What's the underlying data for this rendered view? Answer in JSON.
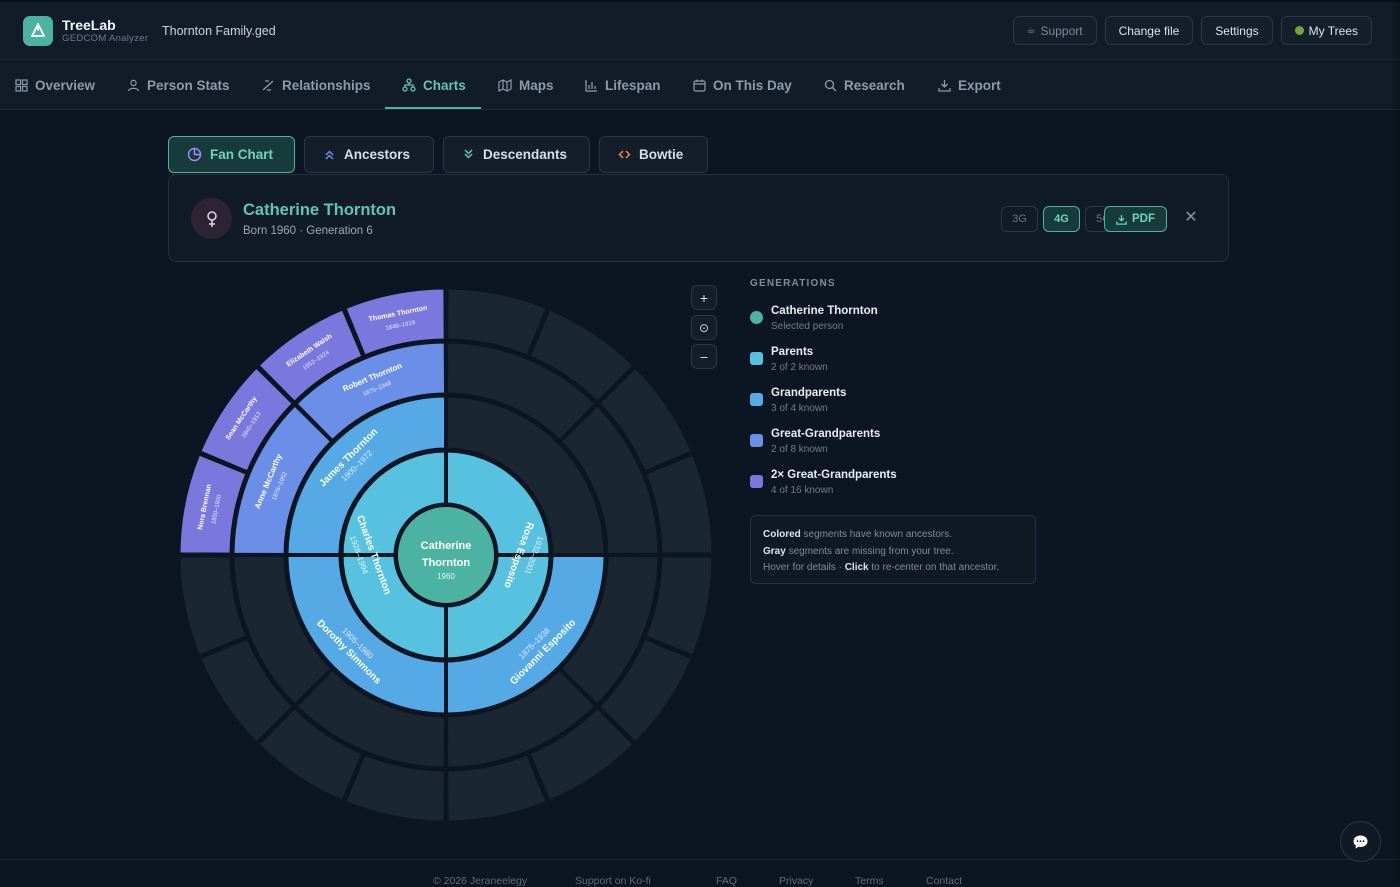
{
  "app": {
    "name": "TreeLab",
    "subtitle": "GEDCOM Analyzer",
    "file": "Thornton Family.ged"
  },
  "top_actions": {
    "support": "Support",
    "change_file": "Change file",
    "settings": "Settings",
    "my_trees": "My Trees"
  },
  "nav": {
    "tabs": [
      {
        "label": "Overview",
        "icon": "grid-icon"
      },
      {
        "label": "Person Stats",
        "icon": "user-icon"
      },
      {
        "label": "Relationships",
        "icon": "link-icon"
      },
      {
        "label": "Charts",
        "icon": "tree-chart-icon"
      },
      {
        "label": "Maps",
        "icon": "map-icon"
      },
      {
        "label": "Lifespan",
        "icon": "bar-chart-icon"
      },
      {
        "label": "On This Day",
        "icon": "calendar-icon"
      },
      {
        "label": "Research",
        "icon": "search-icon"
      },
      {
        "label": "Export",
        "icon": "download-icon"
      }
    ],
    "active": "Charts"
  },
  "chart_tabs": [
    {
      "label": "Fan Chart",
      "icon": "pie-icon"
    },
    {
      "label": "Ancestors",
      "icon": "chevrons-up-icon"
    },
    {
      "label": "Descendants",
      "icon": "chevrons-down-icon"
    },
    {
      "label": "Bowtie",
      "icon": "code-brackets-icon"
    }
  ],
  "person": {
    "name": "Catherine Thornton",
    "meta": "Born 1960 · Generation 6",
    "center_name_1": "Catherine",
    "center_name_2": "Thornton",
    "center_year": "1960"
  },
  "generation_options": [
    "3G",
    "4G",
    "5G"
  ],
  "selected_generations": "4G",
  "pdf_label": "PDF",
  "zoom": {
    "in": "+",
    "reset": "⊙",
    "out": "−"
  },
  "legend": {
    "title": "GENERATIONS",
    "items": [
      {
        "label": "Catherine Thornton",
        "sub": "Selected person",
        "color": "#4cb3a2"
      },
      {
        "label": "Parents",
        "sub": "2 of 2 known",
        "color": "#56c2df"
      },
      {
        "label": "Grandparents",
        "sub": "3 of 4 known",
        "color": "#55a9e4"
      },
      {
        "label": "Great-Grandparents",
        "sub": "2 of 8 known",
        "color": "#6b8fe6"
      },
      {
        "label": "2× Great-Grandparents",
        "sub": "4 of 16 known",
        "color": "#7b78dd"
      }
    ]
  },
  "info": {
    "line1_bold": "Colored",
    "line1": " segments have known ancestors.",
    "line2_bold": "Gray",
    "line2": " segments are missing from your tree.",
    "line3": "Hover for details · ",
    "line3_bold": "Click",
    "line3_end": " to re-center on that ancestor."
  },
  "chart_data": {
    "type": "fan",
    "root": {
      "name": "Catherine Thornton",
      "years": "1960"
    },
    "ancestors": [
      {
        "gen": 1,
        "slot": 0,
        "name": "Charles Thornton",
        "years": "1928–1994"
      },
      {
        "gen": 1,
        "slot": 1,
        "name": "Rosa Esposito",
        "years": "1932–2001"
      },
      {
        "gen": 2,
        "slot": 0,
        "name": "James Thornton",
        "years": "1900–1972"
      },
      {
        "gen": 2,
        "slot": 1,
        "name": "Dorothy Simmons",
        "years": "1905–1980"
      },
      {
        "gen": 2,
        "slot": 2,
        "name": "Giovanni Esposito",
        "years": "1875–1938"
      },
      {
        "gen": 3,
        "slot": 0,
        "name": "Robert Thornton",
        "years": "1875–1948"
      },
      {
        "gen": 3,
        "slot": 1,
        "name": "Anne McCarthy",
        "years": "1878–1952"
      },
      {
        "gen": 4,
        "slot": 0,
        "name": "Thomas Thornton",
        "years": "1848–1919"
      },
      {
        "gen": 4,
        "slot": 1,
        "name": "Elizabeth Walsh",
        "years": "1852–1924"
      },
      {
        "gen": 4,
        "slot": 2,
        "name": "Sean McCarthy",
        "years": "1845–1913"
      },
      {
        "gen": 4,
        "slot": 3,
        "name": "Nora Brennan",
        "years": "1850–1920"
      }
    ]
  },
  "footer": {
    "copyright": "© 2026 Jeraneelegy",
    "kofi": "Support on Ko-fi",
    "faq": "FAQ",
    "privacy": "Privacy",
    "terms": "Terms",
    "contact": "Contact"
  }
}
